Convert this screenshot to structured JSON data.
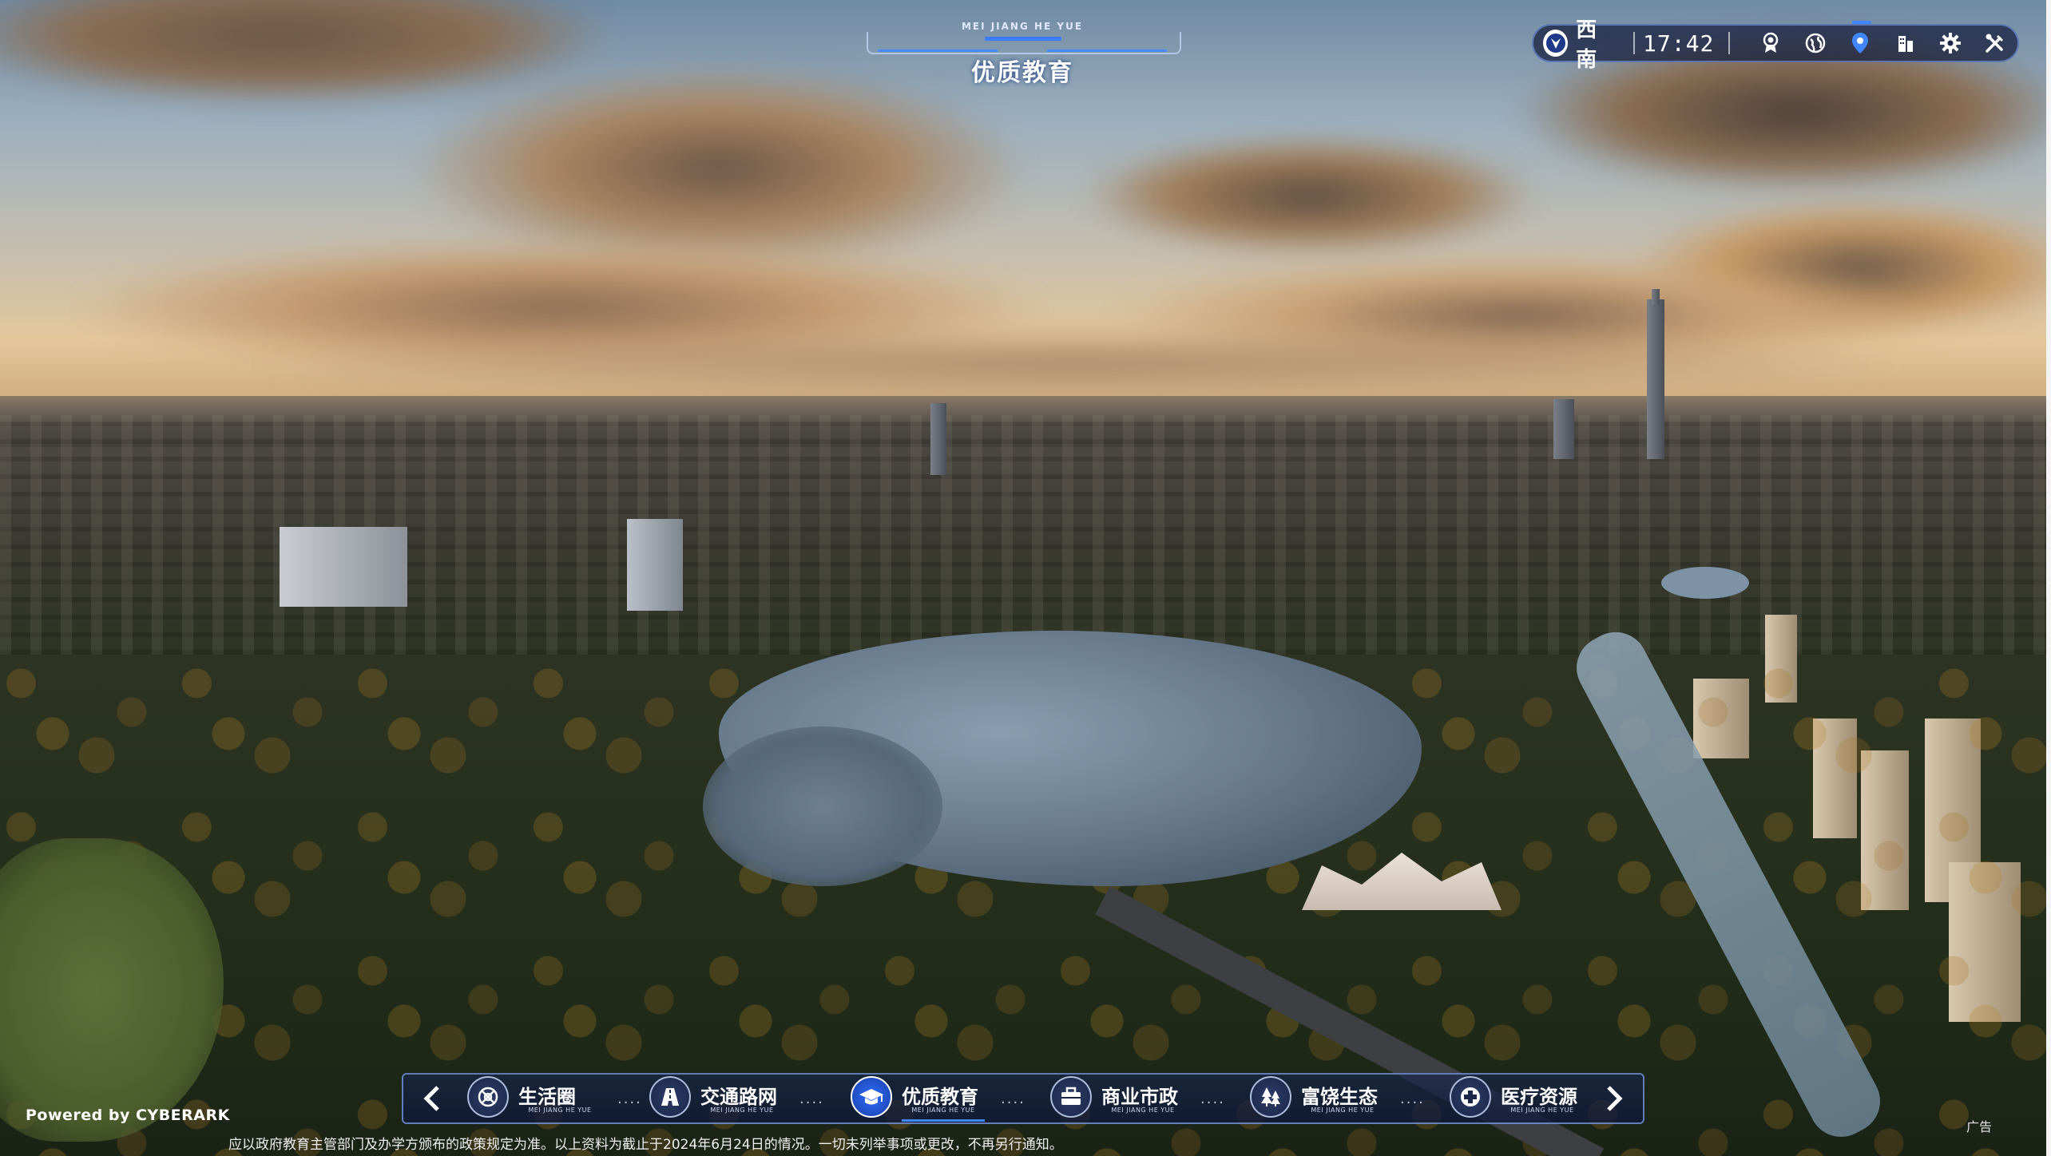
{
  "header": {
    "title_en": "MEI JIANG HE YUE",
    "title_cn": "优质教育"
  },
  "status_bar": {
    "direction": "西南",
    "time": "17:42",
    "icons": [
      "medal-icon",
      "globe-icon",
      "location-pin-icon",
      "building-icon",
      "gear-icon",
      "tools-icon"
    ],
    "active_icon": "location-pin-icon"
  },
  "nav": {
    "items": [
      {
        "label": "生活圈",
        "sub": "MEI JIANG HE YUE",
        "icon": "lifestyle-icon"
      },
      {
        "label": "交通路网",
        "sub": "MEI JIANG HE YUE",
        "icon": "road-icon"
      },
      {
        "label": "优质教育",
        "sub": "MEI JIANG HE YUE",
        "icon": "graduation-cap-icon",
        "active": true
      },
      {
        "label": "商业市政",
        "sub": "MEI JIANG HE YUE",
        "icon": "briefcase-icon"
      },
      {
        "label": "富饶生态",
        "sub": "MEI JIANG HE YUE",
        "icon": "trees-icon"
      },
      {
        "label": "医疗资源",
        "sub": "MEI JIANG HE YUE",
        "icon": "medical-cross-icon"
      }
    ],
    "separator": "...."
  },
  "footer": {
    "powered": "Powered by CYBERARK",
    "notice": "应以政府教育主管部门及办学方颁布的政策规定为准。以上资料为截止于2024年6月24日的情况。一切未列举事项或更改，不再另行通知。",
    "ad": "广告"
  },
  "colors": {
    "accent": "#3f86ff",
    "panel": "#121a3a"
  }
}
